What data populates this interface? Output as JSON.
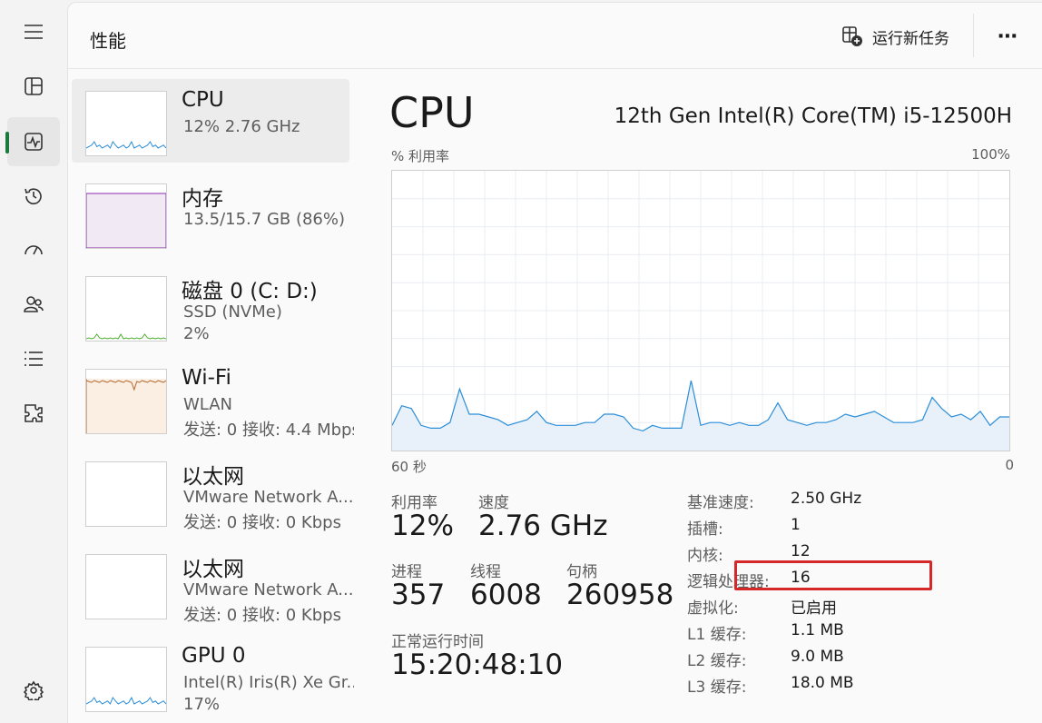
{
  "header": {
    "title": "性能",
    "run_new_task": "运行新任务",
    "more": "⋯"
  },
  "nav": {
    "items": [
      "hamburger-icon",
      "processes-icon",
      "performance-icon",
      "app-history-icon",
      "startup-apps-icon",
      "users-icon",
      "details-icon",
      "services-icon",
      "settings-icon"
    ]
  },
  "resources": [
    {
      "name": "CPU",
      "line1": "12%  2.76 GHz",
      "line2": ""
    },
    {
      "name": "内存",
      "line1": "13.5/15.7 GB (86%)",
      "line2": ""
    },
    {
      "name": "磁盘 0 (C: D:)",
      "line1": "SSD (NVMe)",
      "line2": "2%"
    },
    {
      "name": "Wi-Fi",
      "line1": "WLAN",
      "line2": "发送: 0 接收: 4.4 Mbps"
    },
    {
      "name": "以太网",
      "line1": "VMware Network A...",
      "line2": "发送: 0 接收: 0 Kbps"
    },
    {
      "name": "以太网",
      "line1": "VMware Network A...",
      "line2": "发送: 0 接收: 0 Kbps"
    },
    {
      "name": "GPU 0",
      "line1": "Intel(R) Iris(R) Xe Gr...",
      "line2": "17%"
    }
  ],
  "detail": {
    "title": "CPU",
    "model": "12th Gen Intel(R) Core(TM) i5-12500H",
    "y_label": "% 利用率",
    "y_max_label": "100%",
    "x_left_label": "60 秒",
    "x_right_label": "0",
    "stats": {
      "utilization_label": "利用率",
      "utilization": "12%",
      "speed_label": "速度",
      "speed": "2.76 GHz",
      "processes_label": "进程",
      "processes": "357",
      "threads_label": "线程",
      "threads": "6008",
      "handles_label": "句柄",
      "handles": "260958",
      "uptime_label": "正常运行时间",
      "uptime": "15:20:48:10"
    },
    "specs": [
      {
        "key": "基准速度:",
        "value": "2.50 GHz"
      },
      {
        "key": "插槽:",
        "value": "1"
      },
      {
        "key": "内核:",
        "value": "12"
      },
      {
        "key": "逻辑处理器:",
        "value": "16"
      },
      {
        "key": "虚拟化:",
        "value": "已启用"
      },
      {
        "key": "L1 缓存:",
        "value": "1.1 MB"
      },
      {
        "key": "L2 缓存:",
        "value": "9.0 MB"
      },
      {
        "key": "L3 缓存:",
        "value": "18.0 MB"
      }
    ]
  },
  "chart_data": {
    "type": "area",
    "x_range": [
      60,
      0
    ],
    "ylim": [
      0,
      100
    ],
    "grid": true,
    "series": [
      {
        "values": [
          9,
          16,
          15,
          9,
          8,
          8,
          10,
          22,
          13,
          13,
          12,
          11,
          9,
          10,
          11,
          14,
          10,
          9,
          9,
          9,
          10,
          10,
          13,
          13,
          12,
          8,
          7,
          9,
          8,
          8,
          8,
          25,
          9,
          10,
          10,
          9,
          10,
          9,
          9,
          11,
          17,
          11,
          10,
          9,
          10,
          10,
          11,
          13,
          12,
          13,
          14,
          12,
          10,
          10,
          10,
          11,
          19,
          15,
          12,
          13,
          11,
          14,
          9,
          12,
          12
        ]
      }
    ]
  },
  "colors": {
    "cpu": "#2c8ed8",
    "memory": "#8b2bb0",
    "disk": "#4caf2c",
    "wifi": "#b4662a",
    "gpu": "#2c8ed8",
    "highlight": "#d62828"
  }
}
